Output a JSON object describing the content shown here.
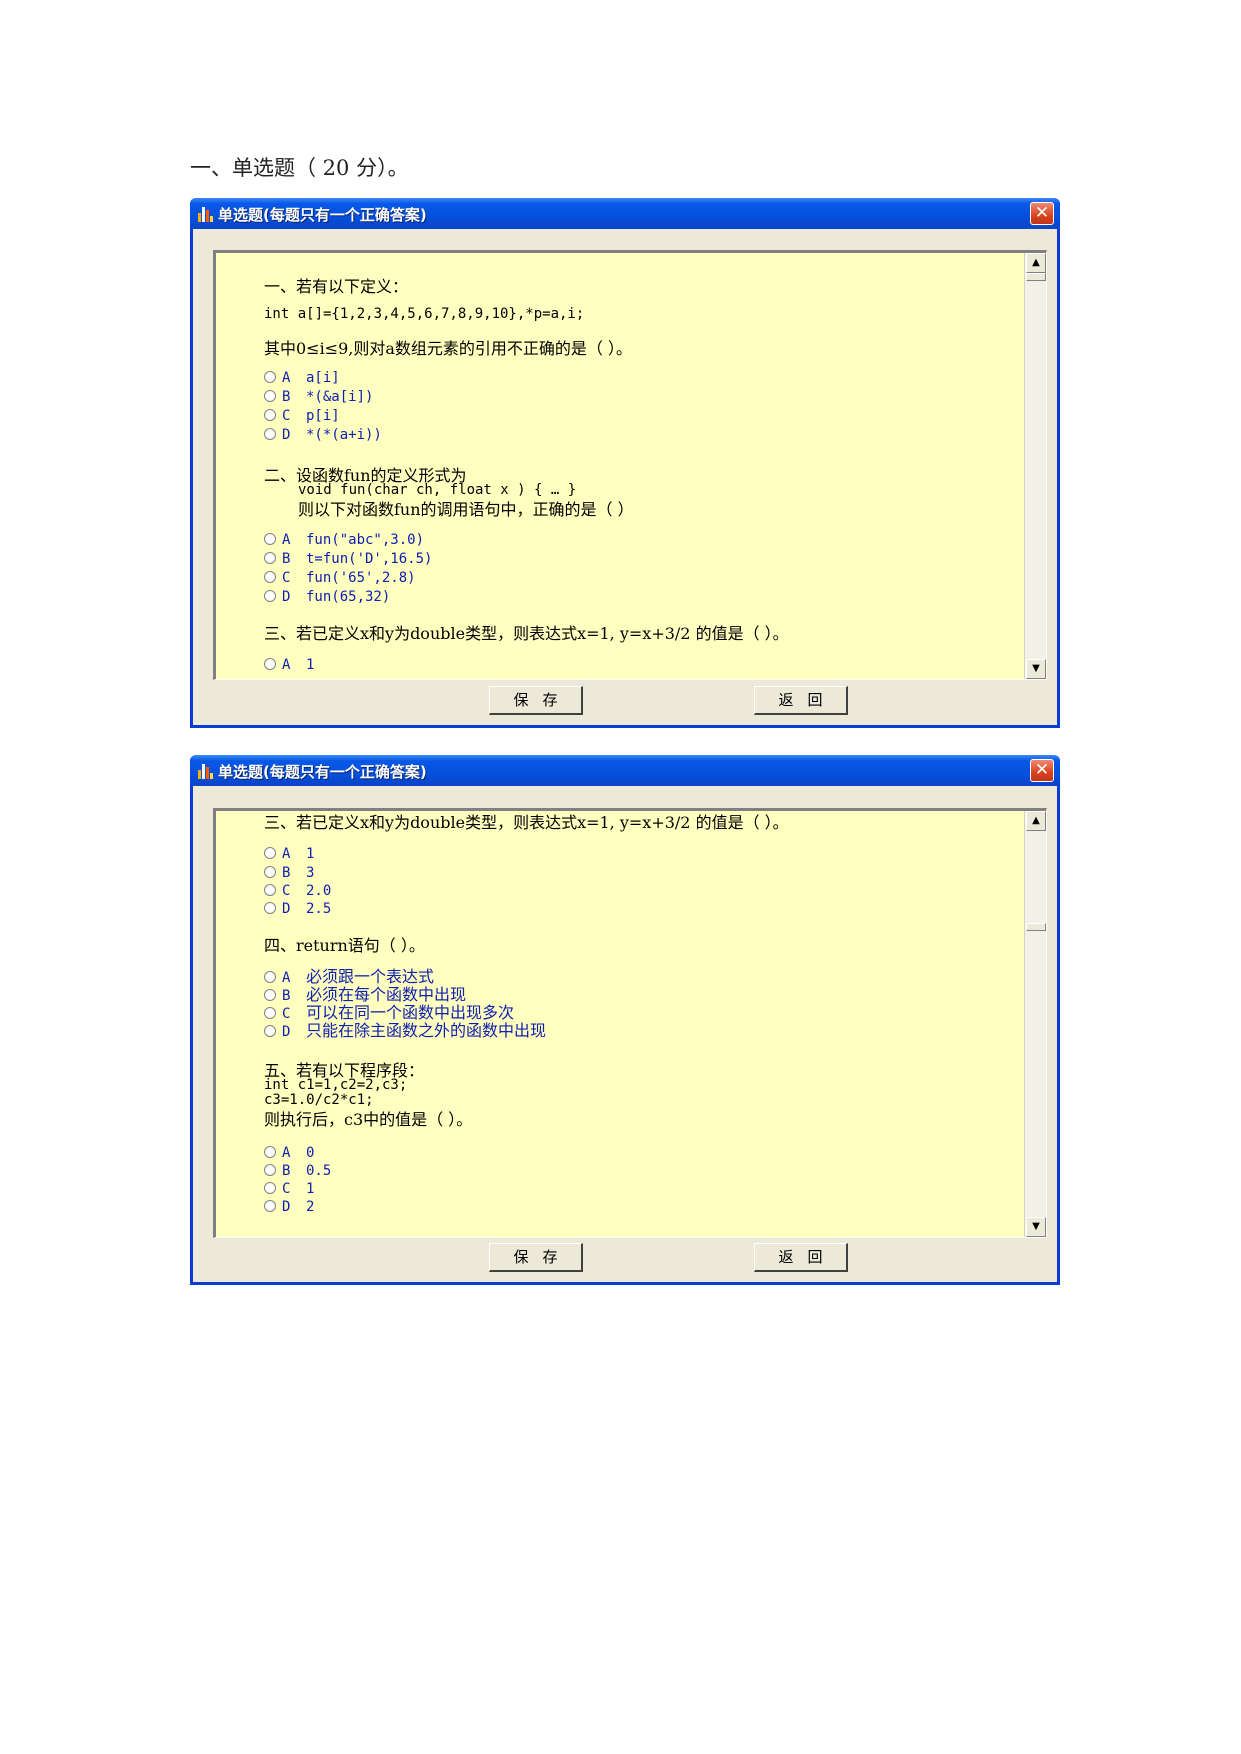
{
  "page": {
    "heading": "一、单选题（ 20 分）。"
  },
  "window_title": "单选题(每题只有一个正确答案)",
  "close_label": "✕",
  "buttons": {
    "save": "保存",
    "back": "返回"
  },
  "window1": {
    "q1": {
      "title": "一、若有以下定义：",
      "code": "int a[]={1,2,3,4,5,6,7,8,9,10},*p=a,i;",
      "question": "其中0≤i≤9,则对a数组元素的引用不正确的是（ ）。",
      "options": [
        {
          "letter": "A",
          "text": "a[i]"
        },
        {
          "letter": "B",
          "text": "*(&a[i])"
        },
        {
          "letter": "C",
          "text": "p[i]"
        },
        {
          "letter": "D",
          "text": "*(*(a+i))"
        }
      ]
    },
    "q2": {
      "title": "二、设函数fun的定义形式为",
      "code": "void fun(char ch, float x ) { … }",
      "question": "则以下对函数fun的调用语句中，正确的是（ ）",
      "options": [
        {
          "letter": "A",
          "text": "fun(\"abc\",3.0)"
        },
        {
          "letter": "B",
          "text": "t=fun('D',16.5)"
        },
        {
          "letter": "C",
          "text": "fun('65',2.8)"
        },
        {
          "letter": "D",
          "text": "fun(65,32)"
        }
      ]
    },
    "q3": {
      "title": "三、若已定义x和y为double类型，则表达式x=1, y=x+3/2 的值是（ ）。",
      "options": [
        {
          "letter": "A",
          "text": "1"
        }
      ]
    }
  },
  "window2": {
    "q3": {
      "title": "三、若已定义x和y为double类型，则表达式x=1, y=x+3/2 的值是（ ）。",
      "options": [
        {
          "letter": "A",
          "text": "1"
        },
        {
          "letter": "B",
          "text": "3"
        },
        {
          "letter": "C",
          "text": "2.0"
        },
        {
          "letter": "D",
          "text": "2.5"
        }
      ]
    },
    "q4": {
      "title": "四、return语句（ ）。",
      "options": [
        {
          "letter": "A",
          "text": "必须跟一个表达式"
        },
        {
          "letter": "B",
          "text": "必须在每个函数中出现"
        },
        {
          "letter": "C",
          "text": "可以在同一个函数中出现多次"
        },
        {
          "letter": "D",
          "text": "只能在除主函数之外的函数中出现"
        }
      ]
    },
    "q5": {
      "title": "五、若有以下程序段：",
      "code1": "int c1=1,c2=2,c3;",
      "code2": "c3=1.0/c2*c1;",
      "question": "则执行后，c3中的值是（ ）。",
      "options": [
        {
          "letter": "A",
          "text": "0"
        },
        {
          "letter": "B",
          "text": "0.5"
        },
        {
          "letter": "C",
          "text": "1"
        },
        {
          "letter": "D",
          "text": "2"
        }
      ]
    }
  },
  "icons": {
    "app": "bar-chart-icon",
    "close": "close-icon",
    "scroll_up": "arrow-up-icon",
    "scroll_down": "arrow-down-icon"
  }
}
